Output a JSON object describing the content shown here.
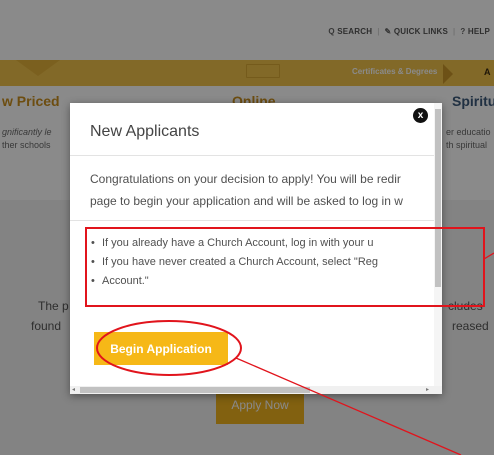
{
  "utility_nav": {
    "search_icon": "Q",
    "search_label": "SEARCH",
    "quick_links_icon": "✎",
    "quick_links_label": "QUICK LINKS",
    "help_icon": "?",
    "help_label": "HELP"
  },
  "band": {
    "certificates_label": "Certificates & Degrees",
    "trailing_letter": "A"
  },
  "features": {
    "left_title": "w Priced",
    "left_text_1": "gnificantly le",
    "left_text_2": "ther schools",
    "center_title": "Online",
    "right_title": "Spiritu",
    "right_text_1": "er educatio",
    "right_text_2": "th spiritual"
  },
  "page_body": {
    "left_line_1": "The p",
    "left_line_2": "found",
    "right_line_1": "cludes",
    "right_line_2": "reased",
    "apply_now_label": "Apply Now"
  },
  "modal": {
    "title": "New Applicants",
    "paragraph_line_1": "Congratulations on your decision to apply! You will be redir",
    "paragraph_line_2": "page to begin your application and will be asked to log in w",
    "bullets": [
      "If you already have a Church Account, log in with your u",
      "If you have never created a Church Account, select \"Reg",
      "Account.\""
    ],
    "begin_button_label": "Begin Application",
    "close_icon": "x"
  },
  "colors": {
    "gold": "#f0c24a",
    "button_gold": "#f6b817",
    "annotation_red": "#e1141c"
  }
}
